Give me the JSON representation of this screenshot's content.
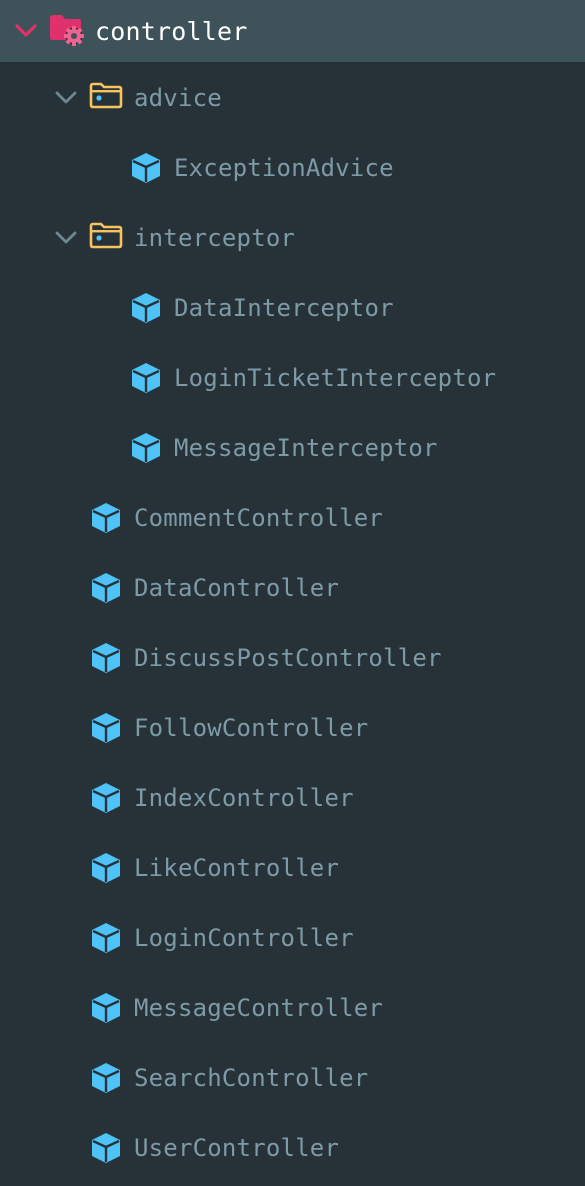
{
  "tree": {
    "root": {
      "label": "controller",
      "icon": "folder-gear-icon",
      "expanded": true,
      "colors": {
        "icon": "#e0316d",
        "chevron": "#e0316d"
      }
    },
    "folders": [
      {
        "label": "advice",
        "icon": "folder-icon",
        "expanded": true,
        "children": [
          {
            "label": "ExceptionAdvice",
            "icon": "class-cube-icon"
          }
        ]
      },
      {
        "label": "interceptor",
        "icon": "folder-icon",
        "expanded": true,
        "children": [
          {
            "label": "DataInterceptor",
            "icon": "class-cube-icon"
          },
          {
            "label": "LoginTicketInterceptor",
            "icon": "class-cube-icon"
          },
          {
            "label": "MessageInterceptor",
            "icon": "class-cube-icon"
          }
        ]
      }
    ],
    "files": [
      {
        "label": "CommentController",
        "icon": "class-cube-icon"
      },
      {
        "label": "DataController",
        "icon": "class-cube-icon"
      },
      {
        "label": "DiscussPostController",
        "icon": "class-cube-icon"
      },
      {
        "label": "FollowController",
        "icon": "class-cube-icon"
      },
      {
        "label": "IndexController",
        "icon": "class-cube-icon"
      },
      {
        "label": "LikeController",
        "icon": "class-cube-icon"
      },
      {
        "label": "LoginController",
        "icon": "class-cube-icon"
      },
      {
        "label": "MessageController",
        "icon": "class-cube-icon"
      },
      {
        "label": "SearchController",
        "icon": "class-cube-icon"
      },
      {
        "label": "UserController",
        "icon": "class-cube-icon"
      }
    ],
    "colors": {
      "background": "#263238",
      "selected_row": "#3e525a",
      "text": "#7e9aa6",
      "folder": "#f7c35f",
      "class_icon": "#4fc3f7",
      "chevron": "#6e8791"
    }
  }
}
